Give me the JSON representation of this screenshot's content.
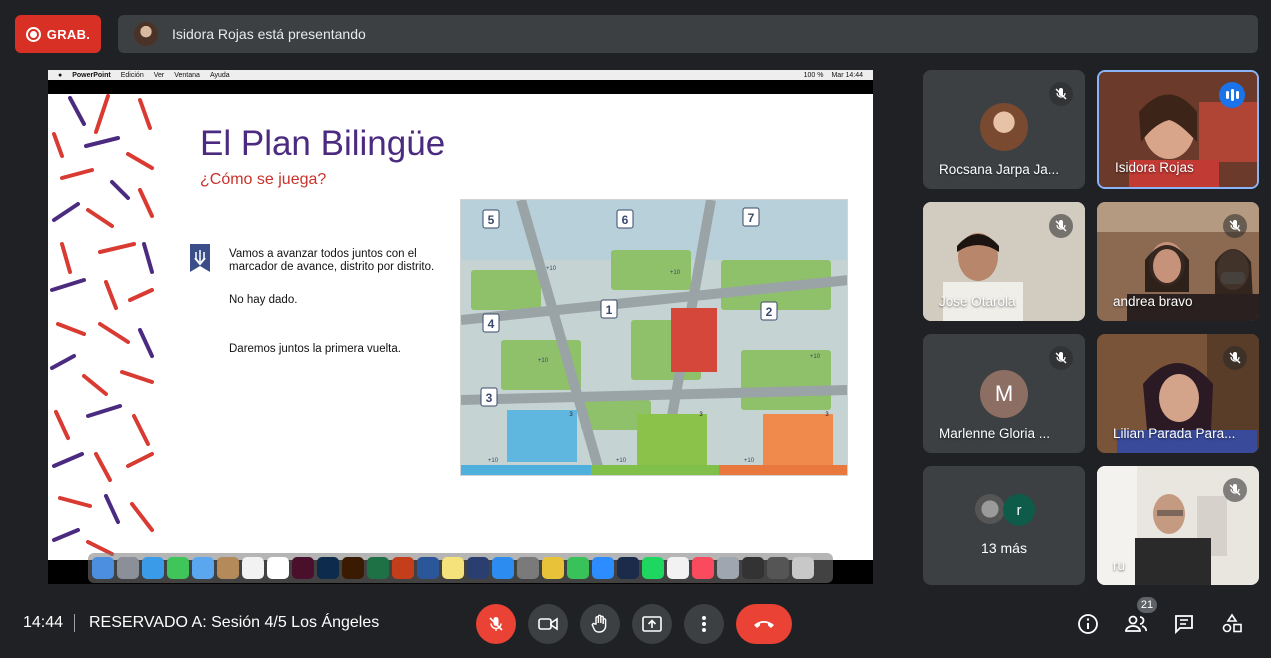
{
  "recording": {
    "label": "GRAB."
  },
  "presenting_banner": {
    "text": "Isidora Rojas está presentando"
  },
  "mac_menubar": {
    "app": "PowerPoint",
    "menus": [
      "Edición",
      "Ver",
      "Ventana",
      "Ayuda"
    ],
    "battery": "100 %",
    "clock": "Mar 14:44"
  },
  "slide": {
    "title": "El Plan Bilingüe",
    "subtitle": "¿Cómo se juega?",
    "text_line1": "Vamos a avanzar todos juntos con el",
    "text_line2": "marcador de avance, distrito por distrito.",
    "text_no_dice": "No hay dado.",
    "text_first_round": "Daremos juntos la primera vuelta.",
    "board_numbers": [
      "5",
      "6",
      "7",
      "1",
      "2",
      "4",
      "3"
    ],
    "board_bonus": [
      "+10",
      "+10",
      "+10",
      "+10",
      "+10",
      "+10",
      "+10"
    ],
    "board_card_labels": [
      "3",
      "3",
      "3"
    ]
  },
  "participants": [
    {
      "name": "Rocsana Jarpa Ja...",
      "muted": true
    },
    {
      "name": "Isidora Rojas",
      "speaking": true
    },
    {
      "name": "Jose Otarola",
      "muted": true
    },
    {
      "name": "andrea bravo",
      "muted": true
    },
    {
      "name": "Marlenne Gloria ...",
      "initial": "M",
      "muted": true
    },
    {
      "name": "Lilian Parada Para...",
      "muted": true
    },
    {
      "name": "13 más",
      "initial": "r"
    },
    {
      "name": "ru",
      "muted": true
    }
  ],
  "bottom_bar": {
    "time": "14:44",
    "meeting_title": "RESERVADO A: Sesión 4/5 Los Ángeles",
    "people_count": "21"
  },
  "colors": {
    "record_red": "#d93025",
    "end_call_red": "#ea4335",
    "slide_title_purple": "#4b2b7f",
    "slide_subtitle_red": "#c8322a",
    "speaking_blue": "#1a73e8"
  }
}
